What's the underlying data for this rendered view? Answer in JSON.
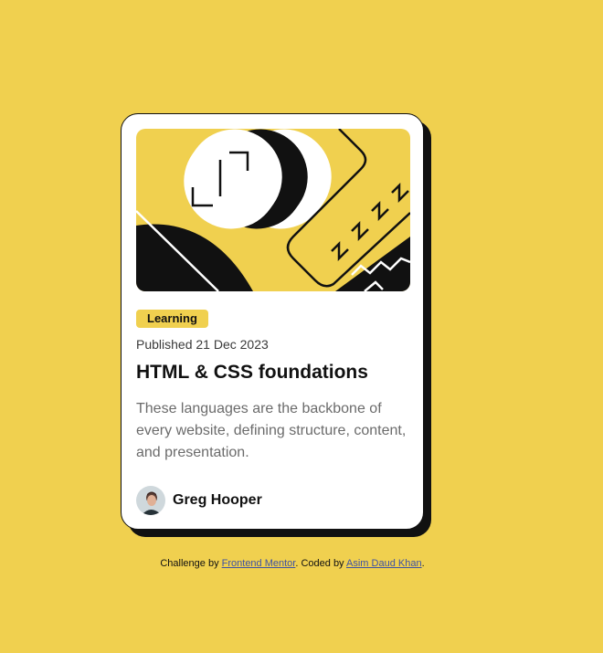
{
  "card": {
    "tag": "Learning",
    "published": "Published 21 Dec 2023",
    "title": "HTML & CSS foundations",
    "description": "These languages are the backbone of every website, defining structure, content, and presentation.",
    "author": "Greg Hooper"
  },
  "attribution": {
    "prefix": "Challenge by",
    "link1": "Frontend Mentor",
    "middle": ". Coded by",
    "link2": "Asim Daud Khan",
    "suffix": "."
  },
  "colors": {
    "background": "#F0D04F",
    "card": "#FFFFFF",
    "ink": "#111111",
    "muted": "#6B6B6B"
  }
}
